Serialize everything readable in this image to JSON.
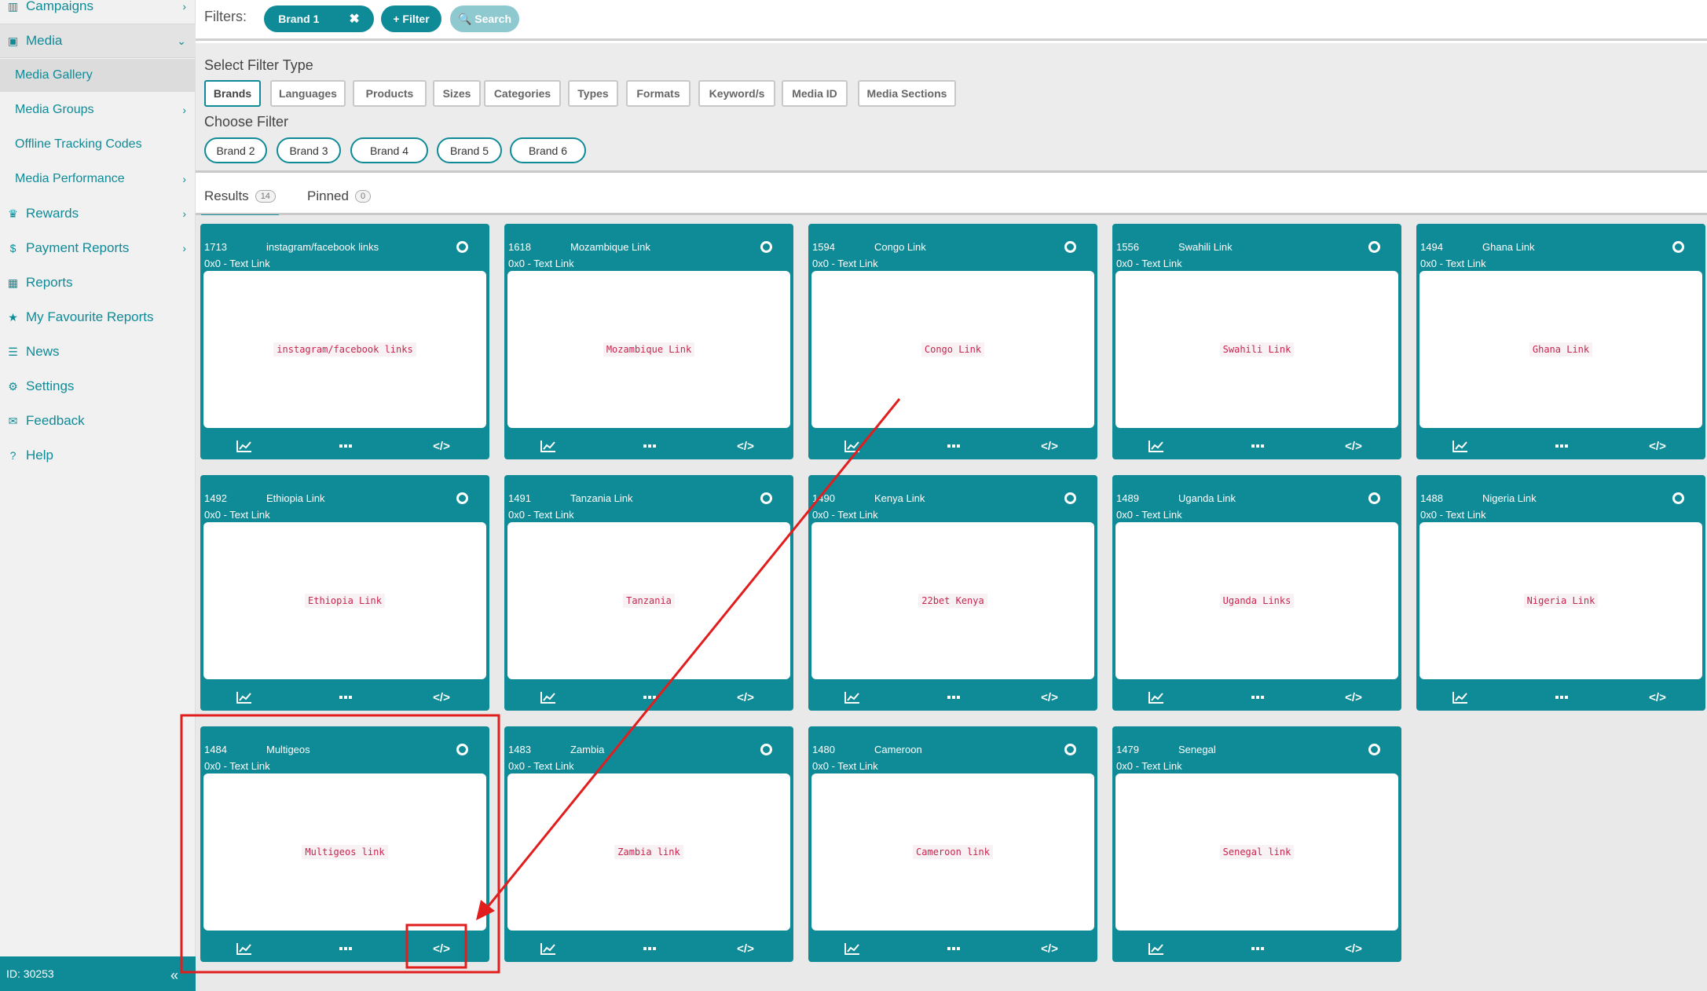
{
  "sidebar": {
    "items": [
      {
        "label": "Campaigns",
        "icon": "bar-chart-icon",
        "glyph": "▥"
      },
      {
        "label": "Media",
        "icon": "image-icon",
        "glyph": "▣"
      },
      {
        "label": "Media Gallery"
      },
      {
        "label": "Media Groups"
      },
      {
        "label": "Offline Tracking Codes"
      },
      {
        "label": "Media Performance"
      },
      {
        "label": "Rewards",
        "icon": "trophy-icon",
        "glyph": "♛"
      },
      {
        "label": "Payment Reports",
        "icon": "dollar-icon",
        "glyph": "$"
      },
      {
        "label": "Reports",
        "icon": "table-icon",
        "glyph": "▦"
      },
      {
        "label": "My Favourite Reports",
        "icon": "star-icon",
        "glyph": "★"
      },
      {
        "label": "News",
        "icon": "list-icon",
        "glyph": "☰"
      },
      {
        "label": "Settings",
        "icon": "gear-icon",
        "glyph": "⚙"
      },
      {
        "label": "Feedback",
        "icon": "comment-icon",
        "glyph": "✉"
      },
      {
        "label": "Help",
        "icon": "question-icon",
        "glyph": "?"
      }
    ],
    "footer_id": "ID: 30253",
    "collapse_glyph": "«"
  },
  "filters": {
    "label": "Filters:",
    "active_chip": "Brand 1",
    "remove_glyph": "✖",
    "add_filter": "+ Filter",
    "search": "🔍 Search"
  },
  "filter_panel": {
    "select_type_label": "Select Filter Type",
    "types": [
      "Brands",
      "Languages",
      "Products",
      "Sizes",
      "Categories",
      "Types",
      "Formats",
      "Keyword/s",
      "Media ID",
      "Media Sections"
    ],
    "choose_label": "Choose Filter",
    "choices": [
      "Brand 2",
      "Brand 3",
      "Brand 4",
      "Brand 5",
      "Brand 6"
    ]
  },
  "tabs": {
    "results_label": "Results",
    "results_count": "14",
    "pinned_label": "Pinned",
    "pinned_count": "0"
  },
  "cards": [
    {
      "id": "1713",
      "name": "instagram/facebook links",
      "size": "0x0 - Text Link",
      "preview": "instagram/facebook links"
    },
    {
      "id": "1618",
      "name": "Mozambique Link",
      "size": "0x0 - Text Link",
      "preview": "Mozambique Link"
    },
    {
      "id": "1594",
      "name": "Congo Link",
      "size": "0x0 - Text Link",
      "preview": "Congo Link"
    },
    {
      "id": "1556",
      "name": "Swahili Link",
      "size": "0x0 - Text Link",
      "preview": "Swahili Link"
    },
    {
      "id": "1494",
      "name": "Ghana Link",
      "size": "0x0 - Text Link",
      "preview": "Ghana Link"
    },
    {
      "id": "1492",
      "name": "Ethiopia Link",
      "size": "0x0 - Text Link",
      "preview": "Ethiopia Link"
    },
    {
      "id": "1491",
      "name": "Tanzania Link",
      "size": "0x0 - Text Link",
      "preview": "Tanzania"
    },
    {
      "id": "1490",
      "name": "Kenya Link",
      "size": "0x0 - Text Link",
      "preview": "22bet Kenya"
    },
    {
      "id": "1489",
      "name": "Uganda Link",
      "size": "0x0 - Text Link",
      "preview": "Uganda Links"
    },
    {
      "id": "1488",
      "name": "Nigeria Link",
      "size": "0x0 - Text Link",
      "preview": "Nigeria Link"
    },
    {
      "id": "1484",
      "name": "Multigeos",
      "size": "0x0 - Text Link",
      "preview": "Multigeos link"
    },
    {
      "id": "1483",
      "name": "Zambia",
      "size": "0x0 - Text Link",
      "preview": "Zambia link"
    },
    {
      "id": "1480",
      "name": "Cameroon",
      "size": "0x0 - Text Link",
      "preview": "Cameroon link"
    },
    {
      "id": "1479",
      "name": "Senegal",
      "size": "0x0 - Text Link",
      "preview": "Senegal link"
    }
  ],
  "card_actions": {
    "stats_icon": "chart-line-icon",
    "more_icon": "ellipsis-icon",
    "code_icon": "code-icon",
    "code_glyph": "</>"
  },
  "annotation": {
    "color": "#e11d1d"
  },
  "colors": {
    "teal": "#0f8b97",
    "light_teal": "#8ec9cf",
    "code_red": "#c7254e"
  }
}
